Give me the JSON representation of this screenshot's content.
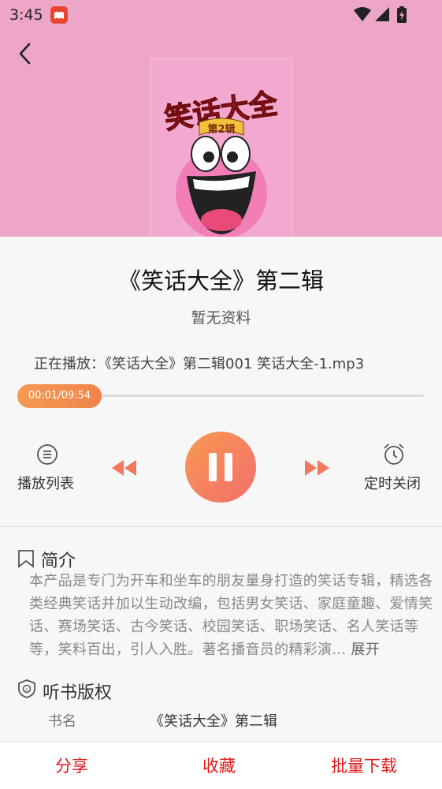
{
  "status_bar": {
    "time": "3:45",
    "icons": [
      "app-notification-icon",
      "wifi-icon",
      "signal-icon",
      "battery-charging-icon"
    ]
  },
  "book": {
    "title": "《笑话大全》第二辑",
    "subtitle": "暂无资料"
  },
  "cover": {
    "title_text": "笑话大全",
    "badge_text": "第2辑"
  },
  "now_playing": "正在播放：《笑话大全》第二辑001 笑话大全-1.mp3",
  "progress": {
    "time_text": "00:01/09:54",
    "fraction": 0.0017
  },
  "controls": {
    "playlist_label": "播放列表",
    "timer_label": "定时关闭"
  },
  "intro": {
    "heading": "简介",
    "text": "本产品是专门为开车和坐车的朋友量身打造的笑话专辑，精选各类经典笑话并加以生动改编，包括男女笑话、家庭童趣、爱情笑话、赛场笑话、古今笑话、校园笑话、职场笑话、名人笑话等等，笑料百出，引人入胜。著名播音员的精彩演...",
    "more": "展开"
  },
  "copyright": {
    "heading": "听书版权",
    "rows": [
      {
        "key": "书名",
        "value": "《笑话大全》第二辑"
      }
    ]
  },
  "bottom_bar": {
    "share": "分享",
    "favorite": "收藏",
    "batch_download": "批量下载"
  },
  "colors": {
    "header_bg": "#eda6c7",
    "accent": "#f0844a",
    "action_red": "#e01919"
  }
}
